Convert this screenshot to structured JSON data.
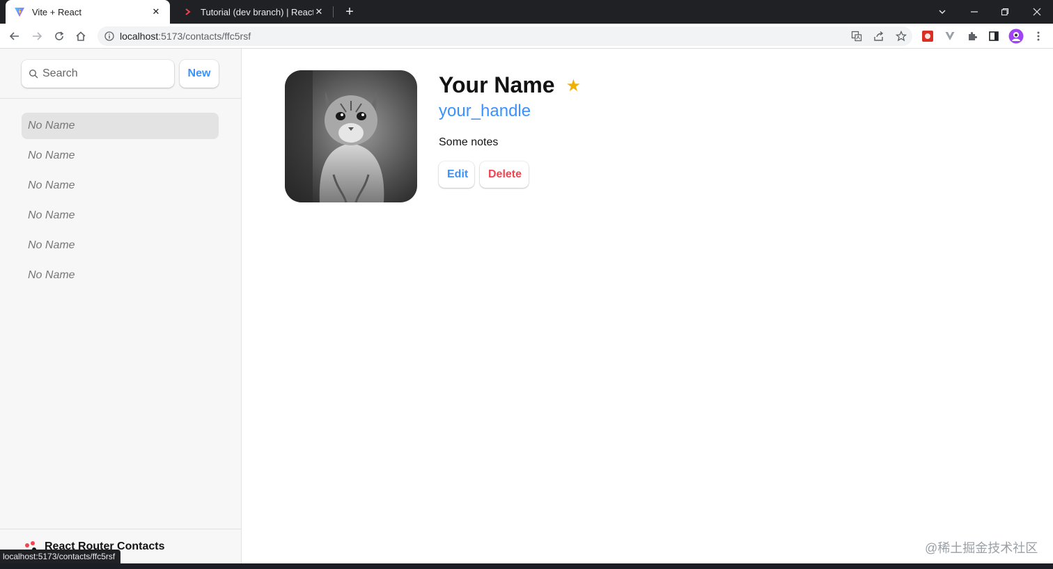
{
  "browser": {
    "tabs": [
      {
        "title": "Vite + React",
        "active": true
      },
      {
        "title": "Tutorial (dev branch) | React Router",
        "active": false
      }
    ],
    "address": {
      "host": "localhost",
      "path": ":5173/contacts/ffc5rsf"
    },
    "status_url": "localhost:5173/contacts/ffc5rsf"
  },
  "sidebar": {
    "search_placeholder": "Search",
    "new_label": "New",
    "contacts": [
      {
        "label": "No Name",
        "active": true
      },
      {
        "label": "No Name",
        "active": false
      },
      {
        "label": "No Name",
        "active": false
      },
      {
        "label": "No Name",
        "active": false
      },
      {
        "label": "No Name",
        "active": false
      },
      {
        "label": "No Name",
        "active": false
      }
    ],
    "brand": "React Router Contacts"
  },
  "contact": {
    "name": "Your Name",
    "favorite_star": "★",
    "handle": "your_handle",
    "notes": "Some notes",
    "edit_label": "Edit",
    "delete_label": "Delete"
  },
  "watermark": "@稀土掘金技术社区",
  "colors": {
    "accent": "#3992ff",
    "danger": "#f44250",
    "star": "#eeb004"
  },
  "icons": [
    "vite-icon",
    "react-router-icon",
    "search-icon",
    "star-icon",
    "back-icon",
    "forward-icon",
    "reload-icon",
    "home-icon",
    "info-icon",
    "translate-icon",
    "share-icon",
    "bookmark-icon",
    "extensions-icon",
    "side-panel-icon",
    "profile-icon",
    "menu-icon"
  ]
}
